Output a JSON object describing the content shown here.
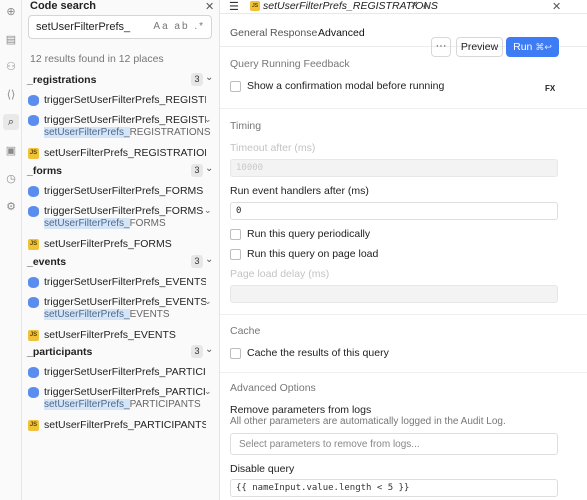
{
  "panel": {
    "title": "Code search",
    "search_value": "setUserFilterPrefs_",
    "search_options": "Aa  ab  .*",
    "results_summary": "12 results found in 12 places",
    "groups": [
      {
        "name": "_registrations",
        "count": "3",
        "items": [
          {
            "icon": "db",
            "text": "triggerSetUserFilterPrefs_REGISTRATIONS",
            "chev": ""
          },
          {
            "icon": "db",
            "text": "triggerSetUserFilterPrefs_REGISTRATIONS",
            "chev": "⌄"
          },
          {
            "icon": "js",
            "text": "setUserFilterPrefs_REGISTRATIONS",
            "chev": ""
          }
        ],
        "sub": {
          "hl": "setUserFilterPrefs_",
          "rest": "REGISTRATIONS"
        }
      },
      {
        "name": "_forms",
        "count": "3",
        "items": [
          {
            "icon": "db",
            "text": "triggerSetUserFilterPrefs_FORMS",
            "chev": ""
          },
          {
            "icon": "db",
            "text": "triggerSetUserFilterPrefs_FORMS →.",
            "chev": "⌄"
          },
          {
            "icon": "js",
            "text": "setUserFilterPrefs_FORMS",
            "chev": ""
          }
        ],
        "sub": {
          "hl": "setUserFilterPrefs_",
          "rest": "FORMS"
        }
      },
      {
        "name": "_events",
        "count": "3",
        "items": [
          {
            "icon": "db",
            "text": "triggerSetUserFilterPrefs_EVENTS",
            "chev": ""
          },
          {
            "icon": "db",
            "text": "triggerSetUserFilterPrefs_EVENTS →.",
            "chev": "⌄"
          },
          {
            "icon": "js",
            "text": "setUserFilterPrefs_EVENTS",
            "chev": ""
          }
        ],
        "sub": {
          "hl": "setUserFilterPrefs_",
          "rest": "EVENTS"
        }
      },
      {
        "name": "_participants",
        "count": "3",
        "items": [
          {
            "icon": "db",
            "text": "triggerSetUserFilterPrefs_PARTICIPANTS",
            "chev": ""
          },
          {
            "icon": "db",
            "text": "triggerSetUserFilterPrefs_PARTICIPANTS",
            "chev": "⌄"
          },
          {
            "icon": "js",
            "text": "setUserFilterPrefs_PARTICIPANTS",
            "chev": ""
          }
        ],
        "sub": {
          "hl": "setUserFilterPrefs_",
          "rest": "PARTICIPANTS"
        }
      }
    ]
  },
  "editor": {
    "tab_name": "setUserFilterPrefs_REGISTRATIONS",
    "tab_icon": "JS",
    "subtabs": [
      "General",
      "Response",
      "Advanced"
    ],
    "more_label": "···",
    "preview_label": "Preview",
    "run_label": "Run",
    "run_shortcut": "⌘↩",
    "fx_label": "FX",
    "sections": {
      "feedback": "Query Running Feedback",
      "confirm_modal": "Show a confirmation modal before running",
      "timing": "Timing",
      "timeout_label": "Timeout after (ms)",
      "timeout_value": "10000",
      "event_handlers_label": "Run event handlers after (ms)",
      "event_handlers_value": "0",
      "periodic": "Run this query periodically",
      "on_page_load": "Run this query on page load",
      "page_load_delay": "Page load delay (ms)",
      "cache": "Cache",
      "cache_results": "Cache the results of this query",
      "advanced": "Advanced Options",
      "remove_params": "Remove parameters from logs",
      "remove_params_hint": "All other parameters are automatically logged in the Audit Log.",
      "remove_params_placeholder": "Select parameters to remove from logs...",
      "disable_query": "Disable query",
      "disable_query_value": "{{ nameInput.value.length < 5 }}"
    }
  },
  "colors": {
    "accent": "#3e7cf5",
    "db_icon": "#5b8def",
    "js_icon": "#f0c239",
    "highlight": "#d5e4f7"
  }
}
